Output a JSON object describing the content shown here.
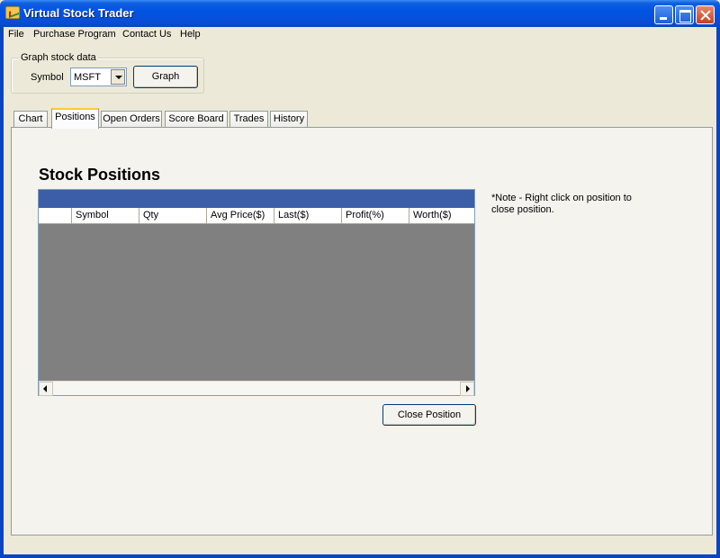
{
  "window": {
    "title": "Virtual Stock Trader"
  },
  "menu": [
    "File",
    "Purchase Program",
    "Contact Us",
    "Help"
  ],
  "graph_group": {
    "legend": "Graph stock data",
    "symbol_label": "Symbol",
    "symbol_value": "MSFT",
    "graph_button": "Graph"
  },
  "tabs": [
    "Chart",
    "Positions",
    "Open Orders",
    "Score Board",
    "Trades",
    "History"
  ],
  "active_tab": "Positions",
  "positions": {
    "heading": "Stock Positions",
    "columns": [
      "",
      "Symbol",
      "Qty",
      "Avg Price($)",
      "Last($)",
      "Profit(%)",
      "Worth($)"
    ],
    "rows": [],
    "note": "*Note - Right click on position to close position.",
    "close_button": "Close Position"
  },
  "colors": {
    "titlebar": "#0054e3",
    "grid_title": "#3c5ea8",
    "grid_body": "#808080",
    "active_tab_accent": "#ffc83c"
  }
}
